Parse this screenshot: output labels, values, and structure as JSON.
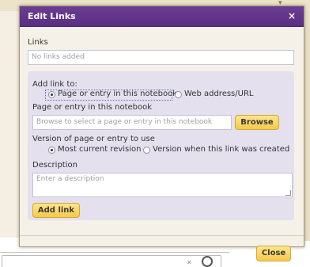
{
  "dialog": {
    "title": "Edit Links",
    "close_x": "×",
    "links_label": "Links",
    "links_value": "No links added",
    "add_link_label": "Add link to:",
    "link_types": [
      {
        "label": "Page or entry in this notebook",
        "selected": true
      },
      {
        "label": "Web address/URL",
        "selected": false
      }
    ],
    "page_entry_label": "Page or entry in this notebook",
    "page_entry_placeholder": "Browse to select a page or entry in this notebook",
    "browse_label": "Browse",
    "version_label": "Version of page or entry to use",
    "versions": [
      {
        "label": "Most current revision",
        "selected": true
      },
      {
        "label": "Version when this link was created",
        "selected": false
      }
    ],
    "description_label": "Description",
    "description_placeholder": "Enter a description",
    "add_link_button": "Add link",
    "close_button": "Close"
  },
  "colors": {
    "titlebar": "#5a2e82",
    "section_bg": "#e5e0ee",
    "button_bg": "#f7c94a",
    "dialog_bg": "#f5f1e8"
  }
}
